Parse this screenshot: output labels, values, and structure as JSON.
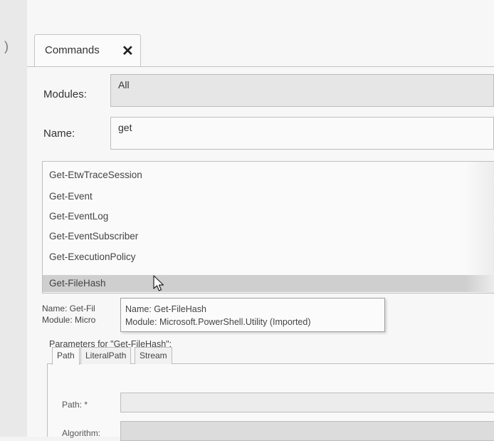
{
  "tab": {
    "label": "Commands",
    "close_glyph": "✕"
  },
  "modules": {
    "label": "Modules:",
    "value": "All"
  },
  "name": {
    "label": "Name:",
    "value": "get"
  },
  "commands": [
    {
      "label": "Get-EtwTraceSession",
      "selected": false
    },
    {
      "label": "Get-Event",
      "selected": false
    },
    {
      "label": "Get-EventLog",
      "selected": false
    },
    {
      "label": "Get-EventSubscriber",
      "selected": false
    },
    {
      "label": "Get-ExecutionPolicy",
      "selected": false
    },
    {
      "label": "Get-FileHash",
      "selected": true
    }
  ],
  "details": {
    "name_line": "Name: Get-Fil",
    "module_line": "Module: Micro"
  },
  "tooltip": {
    "name_line": "Name: Get-FileHash",
    "module_line": "Module: Microsoft.PowerShell.Utility (Imported)"
  },
  "parameters": {
    "label": "Parameters for \"Get-FileHash\":",
    "tabs": [
      "Path",
      "LiteralPath",
      "Stream"
    ],
    "active_tab": "Path",
    "fields": [
      {
        "label": "Path: *",
        "value": ""
      },
      {
        "label": "Algorithm:",
        "value": ""
      }
    ]
  },
  "icons": {
    "cursor": "mouse-pointer-icon",
    "close": "close-icon"
  }
}
